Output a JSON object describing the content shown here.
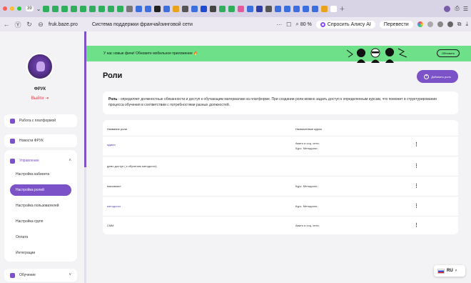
{
  "browser": {
    "tab_count": "39",
    "url_host": "fruk.baze.pro",
    "page_title": "Система поддержки франчайзинговой сети",
    "zoom": "80 %",
    "alice_label": "Спросить Алису AI",
    "translate_label": "Перевести",
    "colors": {
      "tabbar": "#d9d3e6",
      "urlbar": "#ece8f2"
    }
  },
  "sidebar": {
    "user_name": "ФРУК",
    "logout_label": "Выйти",
    "items": [
      {
        "label": "Работа с платформой",
        "icon": "platform-icon"
      },
      {
        "label": "Новости ФРУК",
        "icon": "megaphone-icon"
      },
      {
        "label": "Управление",
        "icon": "gear-icon"
      },
      {
        "label": "Обучение",
        "icon": "book-icon"
      }
    ],
    "submenu": [
      "Настройка кабинета",
      "Настройка ролей",
      "Настройка пользователей",
      "Настройка групп",
      "Оплата",
      "Интеграции"
    ],
    "active_submenu": "Настройка ролей"
  },
  "banner": {
    "text": "У нас новые фичи! Обновите мобильное приложение 🔥",
    "button_label": "Обновить",
    "color": "#6ee08a"
  },
  "main": {
    "title": "Роли",
    "add_button_label": "Добавить роль",
    "description_bold": "Роль",
    "description_text": " - определяет должностные обязанности и доступ к обучающим материалам на платформе. При создании роли можно задать доступ к определенным курсам, что поможет в структурировании процесса обучения в соответствии с потребностями разных должностей.",
    "table": {
      "col_role": "Название роли",
      "col_courses": "Назначенные курсы",
      "rows": [
        {
          "role": "админ",
          "courses": [
            "Авито и соц. сети;",
            "Курс. Методолог;"
          ]
        },
        {
          "role": "демо доступ ( к обучению методолог)",
          "courses": [
            ""
          ]
        },
        {
          "role": "маскамист",
          "courses": [
            "Курс. Методолог;"
          ]
        },
        {
          "role": "методолог",
          "courses": [
            "Курс. Методолог;"
          ]
        },
        {
          "role": "СММ",
          "courses": [
            "Авито и соц. сети;"
          ]
        }
      ]
    }
  },
  "language": {
    "code": "RU"
  },
  "accent_color": "#7b52c7"
}
